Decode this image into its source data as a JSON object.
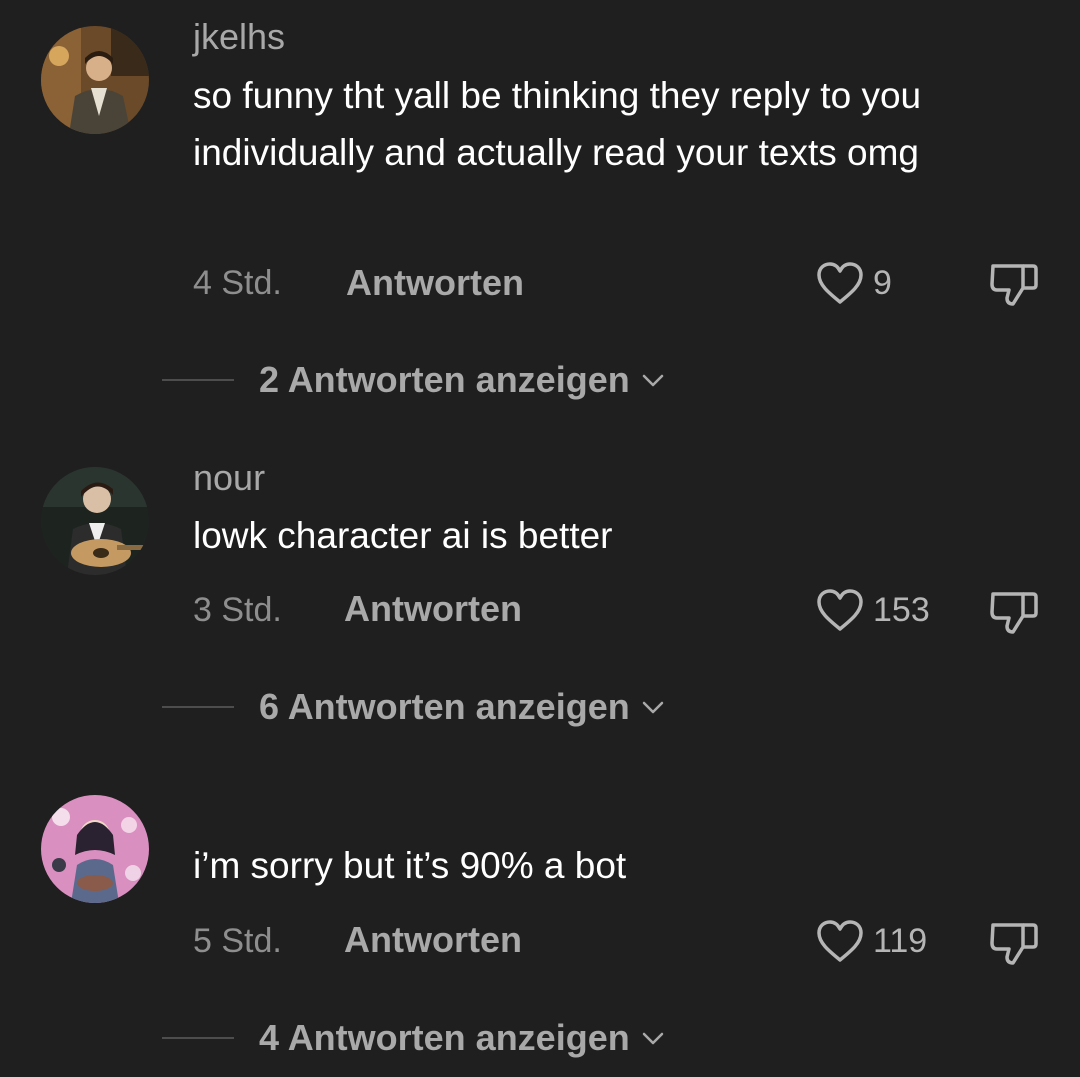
{
  "comments": [
    {
      "username": "jkelhs",
      "text": "so funny tht yall be thinking they reply to you individually and actually read your texts omg",
      "time": "4 Std.",
      "reply_label": "Antworten",
      "likes": "9",
      "replies_label": "2 Antworten anzeigen"
    },
    {
      "username": "nour",
      "text": "lowk character ai is better",
      "time": "3 Std.",
      "reply_label": "Antworten",
      "likes": "153",
      "replies_label": "6 Antworten anzeigen"
    },
    {
      "username": "",
      "text": "i’m sorry but it’s 90% a bot",
      "time": "5 Std.",
      "reply_label": "Antworten",
      "likes": "119",
      "replies_label": "4 Antworten anzeigen"
    }
  ],
  "icons": {
    "like": "heart-outline-icon",
    "dislike": "thumbs-down-outline-icon",
    "expand": "chevron-down-icon"
  },
  "colors": {
    "background": "#1f1f1f",
    "text_primary": "#ffffff",
    "text_secondary": "#a9a9a9",
    "text_muted": "#8e8e8e"
  }
}
